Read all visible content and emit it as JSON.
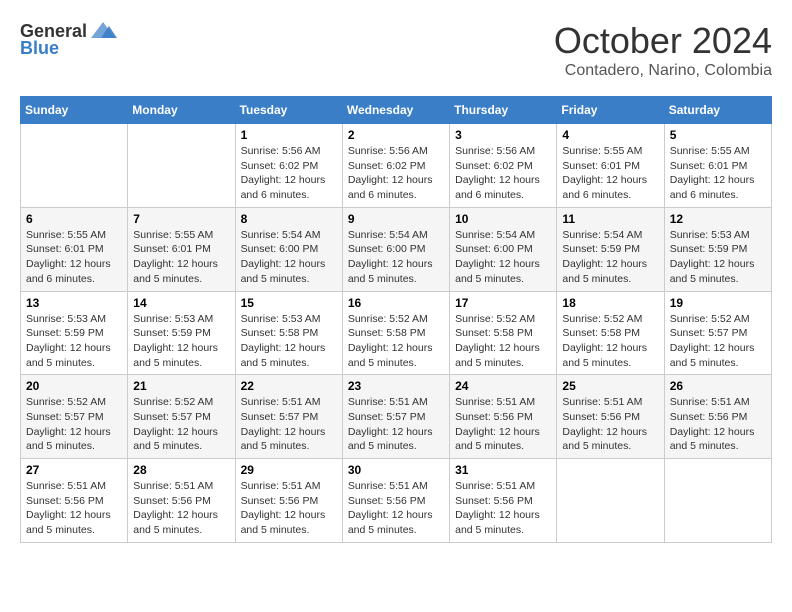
{
  "logo": {
    "general": "General",
    "blue": "Blue"
  },
  "title": {
    "month": "October 2024",
    "location": "Contadero, Narino, Colombia"
  },
  "headers": [
    "Sunday",
    "Monday",
    "Tuesday",
    "Wednesday",
    "Thursday",
    "Friday",
    "Saturday"
  ],
  "weeks": [
    [
      {
        "day": "",
        "info": ""
      },
      {
        "day": "",
        "info": ""
      },
      {
        "day": "1",
        "info": "Sunrise: 5:56 AM\nSunset: 6:02 PM\nDaylight: 12 hours and 6 minutes."
      },
      {
        "day": "2",
        "info": "Sunrise: 5:56 AM\nSunset: 6:02 PM\nDaylight: 12 hours and 6 minutes."
      },
      {
        "day": "3",
        "info": "Sunrise: 5:56 AM\nSunset: 6:02 PM\nDaylight: 12 hours and 6 minutes."
      },
      {
        "day": "4",
        "info": "Sunrise: 5:55 AM\nSunset: 6:01 PM\nDaylight: 12 hours and 6 minutes."
      },
      {
        "day": "5",
        "info": "Sunrise: 5:55 AM\nSunset: 6:01 PM\nDaylight: 12 hours and 6 minutes."
      }
    ],
    [
      {
        "day": "6",
        "info": "Sunrise: 5:55 AM\nSunset: 6:01 PM\nDaylight: 12 hours and 6 minutes."
      },
      {
        "day": "7",
        "info": "Sunrise: 5:55 AM\nSunset: 6:01 PM\nDaylight: 12 hours and 5 minutes."
      },
      {
        "day": "8",
        "info": "Sunrise: 5:54 AM\nSunset: 6:00 PM\nDaylight: 12 hours and 5 minutes."
      },
      {
        "day": "9",
        "info": "Sunrise: 5:54 AM\nSunset: 6:00 PM\nDaylight: 12 hours and 5 minutes."
      },
      {
        "day": "10",
        "info": "Sunrise: 5:54 AM\nSunset: 6:00 PM\nDaylight: 12 hours and 5 minutes."
      },
      {
        "day": "11",
        "info": "Sunrise: 5:54 AM\nSunset: 5:59 PM\nDaylight: 12 hours and 5 minutes."
      },
      {
        "day": "12",
        "info": "Sunrise: 5:53 AM\nSunset: 5:59 PM\nDaylight: 12 hours and 5 minutes."
      }
    ],
    [
      {
        "day": "13",
        "info": "Sunrise: 5:53 AM\nSunset: 5:59 PM\nDaylight: 12 hours and 5 minutes."
      },
      {
        "day": "14",
        "info": "Sunrise: 5:53 AM\nSunset: 5:59 PM\nDaylight: 12 hours and 5 minutes."
      },
      {
        "day": "15",
        "info": "Sunrise: 5:53 AM\nSunset: 5:58 PM\nDaylight: 12 hours and 5 minutes."
      },
      {
        "day": "16",
        "info": "Sunrise: 5:52 AM\nSunset: 5:58 PM\nDaylight: 12 hours and 5 minutes."
      },
      {
        "day": "17",
        "info": "Sunrise: 5:52 AM\nSunset: 5:58 PM\nDaylight: 12 hours and 5 minutes."
      },
      {
        "day": "18",
        "info": "Sunrise: 5:52 AM\nSunset: 5:58 PM\nDaylight: 12 hours and 5 minutes."
      },
      {
        "day": "19",
        "info": "Sunrise: 5:52 AM\nSunset: 5:57 PM\nDaylight: 12 hours and 5 minutes."
      }
    ],
    [
      {
        "day": "20",
        "info": "Sunrise: 5:52 AM\nSunset: 5:57 PM\nDaylight: 12 hours and 5 minutes."
      },
      {
        "day": "21",
        "info": "Sunrise: 5:52 AM\nSunset: 5:57 PM\nDaylight: 12 hours and 5 minutes."
      },
      {
        "day": "22",
        "info": "Sunrise: 5:51 AM\nSunset: 5:57 PM\nDaylight: 12 hours and 5 minutes."
      },
      {
        "day": "23",
        "info": "Sunrise: 5:51 AM\nSunset: 5:57 PM\nDaylight: 12 hours and 5 minutes."
      },
      {
        "day": "24",
        "info": "Sunrise: 5:51 AM\nSunset: 5:56 PM\nDaylight: 12 hours and 5 minutes."
      },
      {
        "day": "25",
        "info": "Sunrise: 5:51 AM\nSunset: 5:56 PM\nDaylight: 12 hours and 5 minutes."
      },
      {
        "day": "26",
        "info": "Sunrise: 5:51 AM\nSunset: 5:56 PM\nDaylight: 12 hours and 5 minutes."
      }
    ],
    [
      {
        "day": "27",
        "info": "Sunrise: 5:51 AM\nSunset: 5:56 PM\nDaylight: 12 hours and 5 minutes."
      },
      {
        "day": "28",
        "info": "Sunrise: 5:51 AM\nSunset: 5:56 PM\nDaylight: 12 hours and 5 minutes."
      },
      {
        "day": "29",
        "info": "Sunrise: 5:51 AM\nSunset: 5:56 PM\nDaylight: 12 hours and 5 minutes."
      },
      {
        "day": "30",
        "info": "Sunrise: 5:51 AM\nSunset: 5:56 PM\nDaylight: 12 hours and 5 minutes."
      },
      {
        "day": "31",
        "info": "Sunrise: 5:51 AM\nSunset: 5:56 PM\nDaylight: 12 hours and 5 minutes."
      },
      {
        "day": "",
        "info": ""
      },
      {
        "day": "",
        "info": ""
      }
    ]
  ]
}
